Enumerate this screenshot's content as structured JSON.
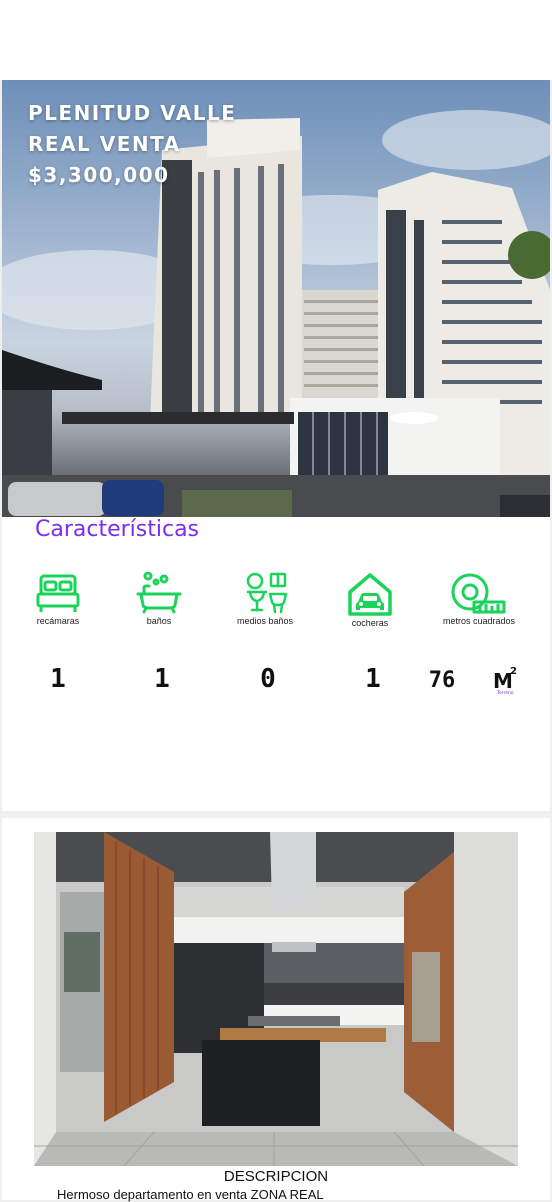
{
  "listing": {
    "title_line1": "PLENITUD VALLE",
    "title_line2": "REAL VENTA",
    "price": "$3,300,000"
  },
  "features": {
    "heading": "Características",
    "accent_color": "#7b2cf5",
    "icon_color": "#19d35a",
    "items": [
      {
        "label": "recámaras",
        "icon": "bed-icon",
        "value": "1"
      },
      {
        "label": "baños",
        "icon": "bathtub-icon",
        "value": "1"
      },
      {
        "label": "medios baños",
        "icon": "half-bath-icon",
        "value": "0"
      },
      {
        "label": "cocheras",
        "icon": "garage-icon",
        "value": "1"
      },
      {
        "label": "metros cuadrados",
        "icon": "tape-measure-icon",
        "value": "76"
      }
    ],
    "area_unit": "M",
    "area_unit_exp": "2",
    "area_unit_note": "Terreno"
  },
  "description": {
    "title": "DESCRIPCION",
    "text": "Hermoso departamento en venta ZONA REAL"
  }
}
